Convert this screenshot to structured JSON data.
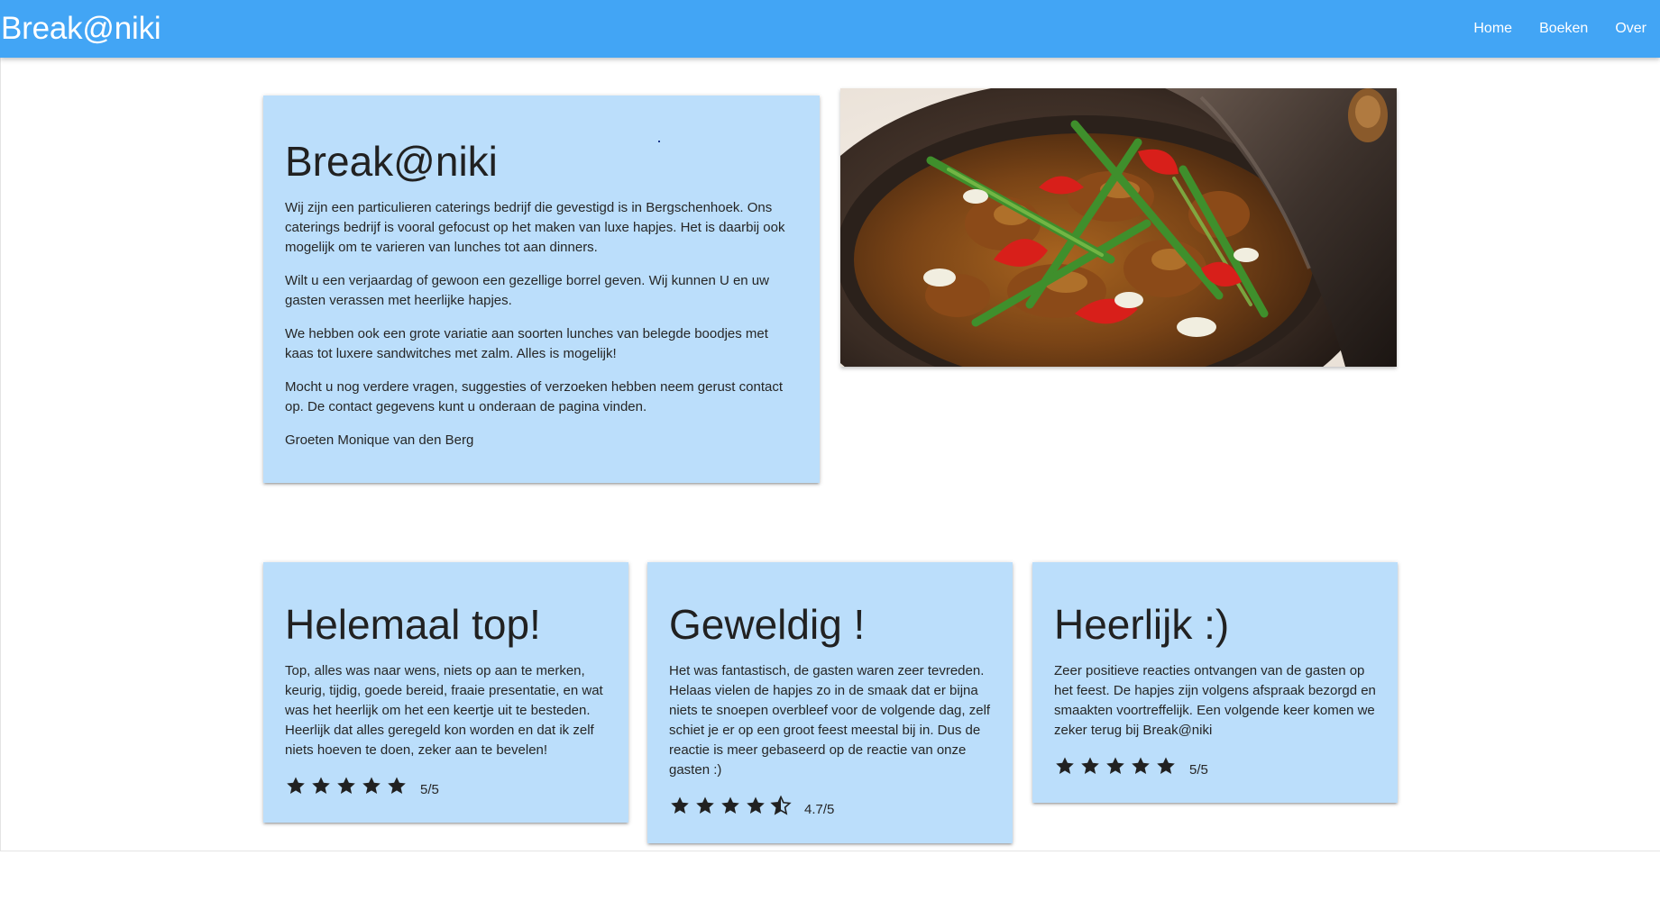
{
  "header": {
    "brand": "Break@niki",
    "nav": [
      {
        "label": "Home"
      },
      {
        "label": "Boeken"
      },
      {
        "label": "Over"
      }
    ]
  },
  "intro": {
    "title": "Break@niki",
    "paragraphs": [
      "Wij zijn een particulieren caterings bedrijf die gevestigd is in Bergschenhoek. Ons caterings bedrijf is vooral gefocust op het maken van luxe hapjes. Het is daarbij ook mogelijk om te varieren van lunches tot aan dinners.",
      "Wilt u een verjaardag of gewoon een gezellige borrel geven. Wij kunnen U en uw gasten verassen met heerlijke hapjes.",
      "We hebben ook een grote variatie aan soorten lunches van belegde boodjes met kaas tot luxere sandwitches met zalm. Alles is mogelijk!",
      "Mocht u nog verdere vragen, suggesties of verzoeken hebben neem gerust contact op. De contact gegevens kunt u onderaan de pagina vinden.",
      "Groeten Monique van den Berg"
    ]
  },
  "reviews": [
    {
      "title": "Helemaal top!",
      "text": "Top, alles was naar wens, niets op aan te merken, keurig, tijdig, goede bereid, fraaie presentatie, en wat was het heerlijk om het een keertje uit te besteden. Heerlijk dat alles geregeld kon worden en dat ik zelf niets hoeven te doen, zeker aan te bevelen!",
      "rating": 5,
      "rating_text": "5/5"
    },
    {
      "title": "Geweldig !",
      "text": "Het was fantastisch, de gasten waren zeer tevreden. Helaas vielen de hapjes zo in de smaak dat er bijna niets te snoepen overbleef voor de volgende dag, zelf schiet je er op een groot feest meestal bij in. Dus de reactie is meer gebaseerd op de reactie van onze gasten :)",
      "rating": 4.7,
      "rating_text": "4.7/5"
    },
    {
      "title": "Heerlijk :)",
      "text": "Zeer positieve reacties ontvangen van de gasten op het feest. De hapjes zijn volgens afspraak bezorgd en smaakten voortreffelijk. Een volgende keer komen we zeker terug bij Break@niki",
      "rating": 5,
      "rating_text": "5/5"
    }
  ],
  "icons": {
    "full_star": "star-icon",
    "half_star": "star-half-icon"
  },
  "colors": {
    "navbar": "#42a5f5",
    "card": "#bbdefb",
    "text": "#212121"
  }
}
